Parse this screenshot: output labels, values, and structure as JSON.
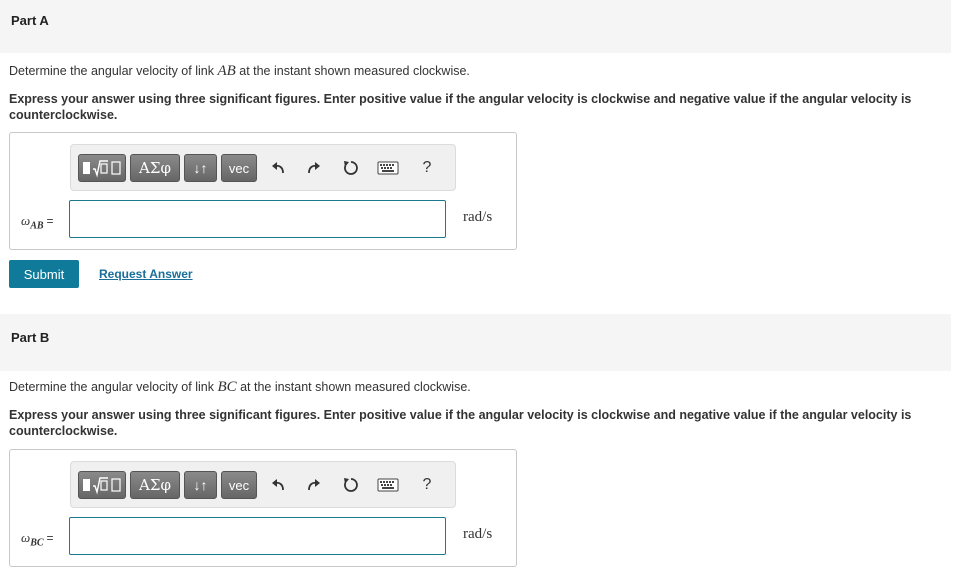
{
  "partA": {
    "title": "Part A",
    "question_pre": "Determine the angular velocity of link ",
    "question_math": "AB",
    "question_post": " at the instant shown measured clockwise.",
    "instruction": "Express your answer using three significant figures. Enter positive value if the angular velocity is clockwise and negative value if the angular velocity is counterclockwise.",
    "var_symbol": "ω",
    "var_sub": "AB",
    "equals": "=",
    "input_value": "",
    "unit": "rad/s",
    "submit_label": "Submit",
    "request_label": "Request Answer"
  },
  "partB": {
    "title": "Part B",
    "question_pre": "Determine the angular velocity of link ",
    "question_math": "BC",
    "question_post": " at the instant shown measured clockwise.",
    "instruction": "Express your answer using three significant figures. Enter positive value if the angular velocity is clockwise and negative value if the angular velocity is counterclockwise.",
    "var_symbol": "ω",
    "var_sub": "BC",
    "equals": "=",
    "input_value": "",
    "unit": "rad/s"
  },
  "toolbar": {
    "greek_label": "ΑΣφ",
    "arrows_label": "↓↑",
    "vec_label": "vec",
    "help_label": "?",
    "icons": [
      "templates-icon",
      "greek-symbols-icon",
      "arrows-icon",
      "vec-icon",
      "undo-icon",
      "redo-icon",
      "reset-icon",
      "keyboard-icon",
      "help-icon"
    ]
  },
  "colors": {
    "submit_bg": "#0f7a99",
    "input_border": "#1a7a8c",
    "link": "#1a6f9a",
    "header_bg": "#f5f5f5"
  }
}
